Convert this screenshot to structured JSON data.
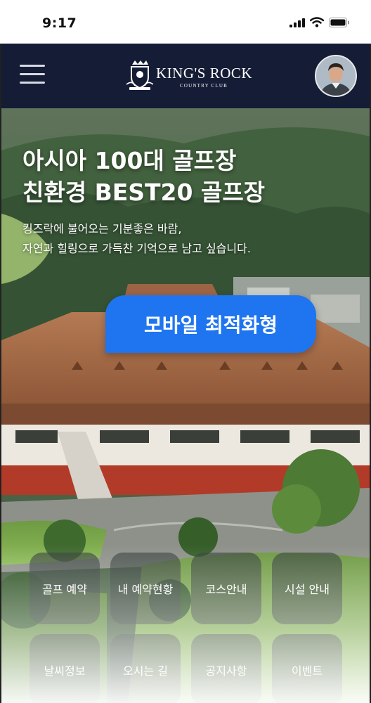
{
  "status_bar": {
    "time": "9:17"
  },
  "header": {
    "logo_text": "KING'S ROCK",
    "logo_subtext": "COUNTRY CLUB"
  },
  "hero": {
    "title_line1": "아시아 100대 골프장",
    "title_line2": "친환경 BEST20 골프장",
    "subtitle_line1": "킹즈락에 불어오는 기분좋은 바람,",
    "subtitle_line2": "자연과 힐링으로 가득찬 기억으로 남고 싶습니다.",
    "badge": "모바일 최적화형"
  },
  "quick_menu": [
    {
      "label": "골프 예약",
      "icon": "golf-reservation"
    },
    {
      "label": "내 예약현황",
      "icon": "my-reservations"
    },
    {
      "label": "코스안내",
      "icon": "course-guide"
    },
    {
      "label": "시설 안내",
      "icon": "facility-guide"
    },
    {
      "label": "날씨정보",
      "icon": "weather"
    },
    {
      "label": "오시는 길",
      "icon": "directions"
    },
    {
      "label": "공지사항",
      "icon": "notice"
    },
    {
      "label": "이벤트",
      "icon": "event"
    }
  ],
  "colors": {
    "header_bg": "#151c35",
    "badge_bg": "#1f75f0",
    "button_bg": "#343e3a"
  }
}
